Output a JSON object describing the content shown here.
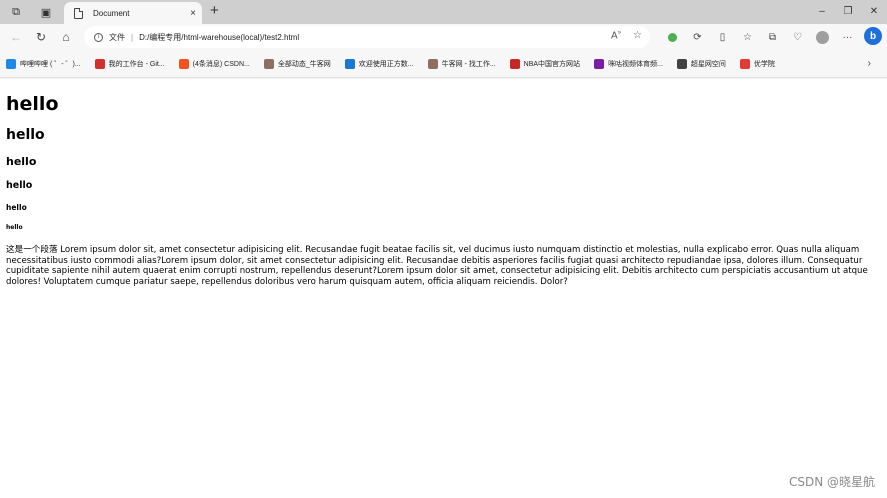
{
  "browser": {
    "tab": {
      "title": "Document",
      "close": "×"
    },
    "new_tab": "+",
    "window_controls": {
      "minimize": "–",
      "restore": "❐",
      "close": "✕"
    },
    "address": {
      "scheme_label": "文件",
      "separator": "|",
      "url": "D:/编程专用/html-warehouse(local)/test2.html"
    },
    "bing_label": "b"
  },
  "bookmarks": [
    {
      "label": "哔哩哔哩 ( ゜- ゜)...",
      "color": "#1e88e5"
    },
    {
      "label": "我的工作台 - Git...",
      "color": "#d32f2f"
    },
    {
      "label": "(4条消息) CSDN...",
      "color": "#f4511e"
    },
    {
      "label": "全部动态_牛客网",
      "color": "#8d6e63"
    },
    {
      "label": "欢迎使用正方数...",
      "color": "#1976d2"
    },
    {
      "label": "牛客网 - 找工作...",
      "color": "#8d6e63"
    },
    {
      "label": "NBA中国官方网站",
      "color": "#c62828"
    },
    {
      "label": "咪咕视频体育频...",
      "color": "#7b1fa2"
    },
    {
      "label": "超星网空间",
      "color": "#424242"
    },
    {
      "label": "优学院",
      "color": "#e53935"
    }
  ],
  "page": {
    "h1": "hello",
    "h2": "hello",
    "h3": "hello",
    "h4": "hello",
    "h5": "hello",
    "h6": "hello",
    "paragraph": "这是一个段落 Lorem ipsum dolor sit, amet consectetur adipisicing elit. Recusandae fugit beatae facilis sit, vel ducimus iusto numquam distinctio et molestias, nulla explicabo error. Quas nulla aliquam necessitatibus iusto commodi alias?Lorem ipsum dolor, sit amet consectetur adipisicing elit. Recusandae debitis asperiores facilis fugiat quasi architecto repudiandae ipsa, dolores illum. Consequatur cupiditate sapiente nihil autem quaerat enim corrupti nostrum, repellendus deserunt?Lorem ipsum dolor sit amet, consectetur adipisicing elit. Debitis architecto cum perspiciatis accusantium ut atque dolores! Voluptatem cumque pariatur saepe, repellendus doloribus vero harum quisquam autem, officia aliquam reiciendis. Dolor?"
  },
  "watermark": "CSDN @晓星航",
  "colors": {
    "tabstrip": "#cfcfcf",
    "toolbar": "#f7f7f7",
    "bing": "#1e6fd9"
  }
}
